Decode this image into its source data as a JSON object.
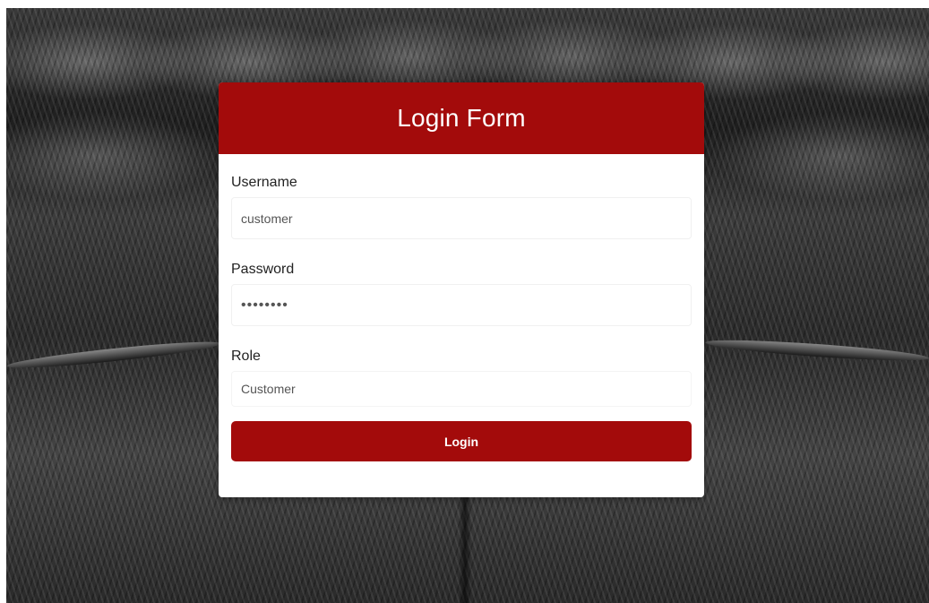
{
  "login_form": {
    "title": "Login Form",
    "username": {
      "label": "Username",
      "value": "customer"
    },
    "password": {
      "label": "Password",
      "value": "customer"
    },
    "role": {
      "label": "Role",
      "selected": "Customer"
    },
    "submit_label": "Login"
  },
  "colors": {
    "accent": "#a30b0b",
    "card_background": "#ffffff"
  }
}
